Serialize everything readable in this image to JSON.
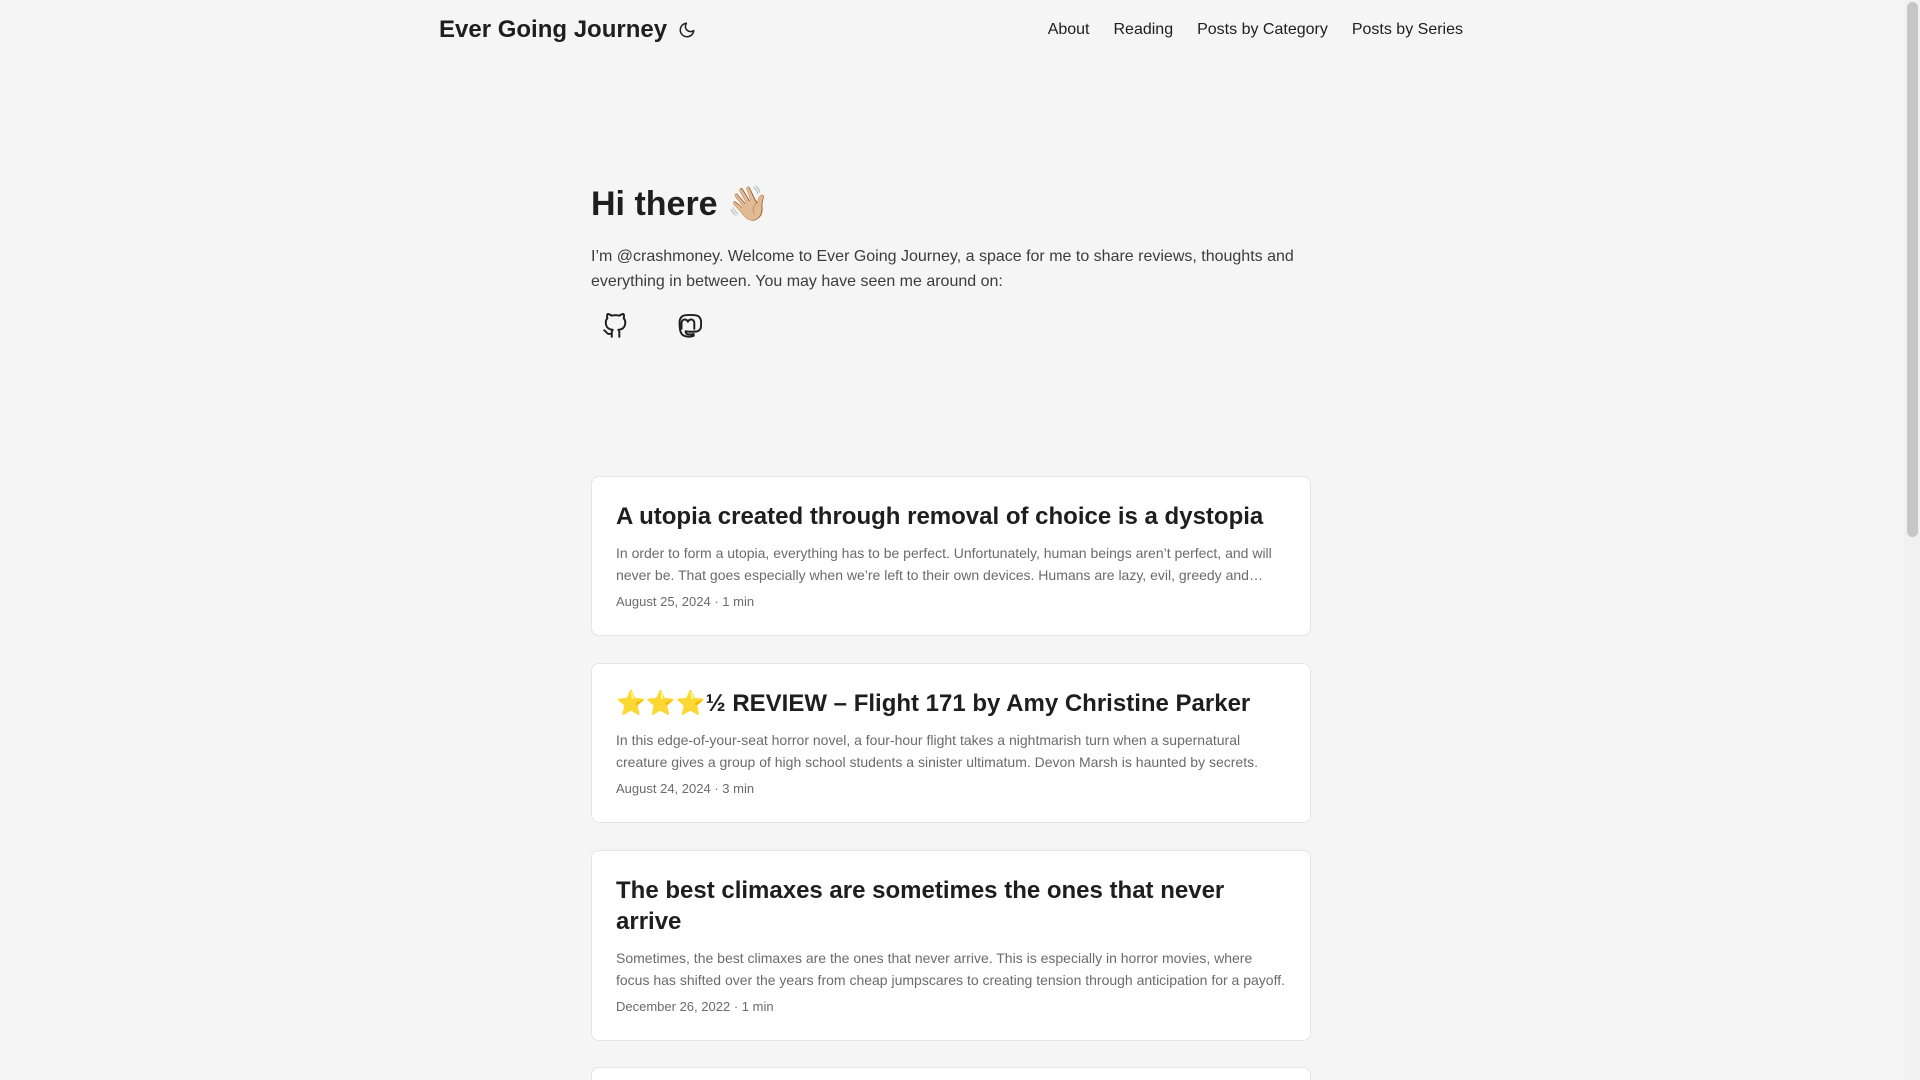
{
  "header": {
    "site_title": "Ever Going Journey",
    "theme_icon": "moon-icon",
    "nav": [
      {
        "label": "About"
      },
      {
        "label": "Reading"
      },
      {
        "label": "Posts by Category"
      },
      {
        "label": "Posts by Series"
      }
    ]
  },
  "intro": {
    "title": "Hi there 👋🏼",
    "text": "I’m @crashmoney. Welcome to Ever Going Journey, a space for me to share reviews, thoughts and everything in between. You may have seen me around on:",
    "social": [
      {
        "icon": "github-icon"
      },
      {
        "icon": "mastodon-icon"
      }
    ]
  },
  "posts": [
    {
      "title": "A utopia created through removal of choice is a dystopia",
      "summary": "In order to form a utopia, everything has to be perfect. Unfortunately, human beings aren’t perfect, and will never be. That goes especially when we’re left to their own devices. Humans are lazy, evil, greedy and more.",
      "date": "August 25, 2024",
      "reading_time": "1 min"
    },
    {
      "title": "⭐⭐⭐½ REVIEW – Flight 171 by Amy Christine Parker",
      "summary": "In this edge-of-your-seat horror novel, a four-hour flight takes a nightmarish turn when a supernatural creature gives a group of high school students a sinister ultimatum. Devon Marsh is haunted by secrets.",
      "date": "August 24, 2024",
      "reading_time": "3 min"
    },
    {
      "title": "The best climaxes are sometimes the ones that never arrive",
      "summary": "Sometimes, the best climaxes are the ones that never arrive. This is especially in horror movies, where focus has shifted over the years from cheap jumpscares to creating tension through anticipation for a payoff.",
      "date": "December 26, 2022",
      "reading_time": "1 min"
    }
  ],
  "meta_separator": "·"
}
